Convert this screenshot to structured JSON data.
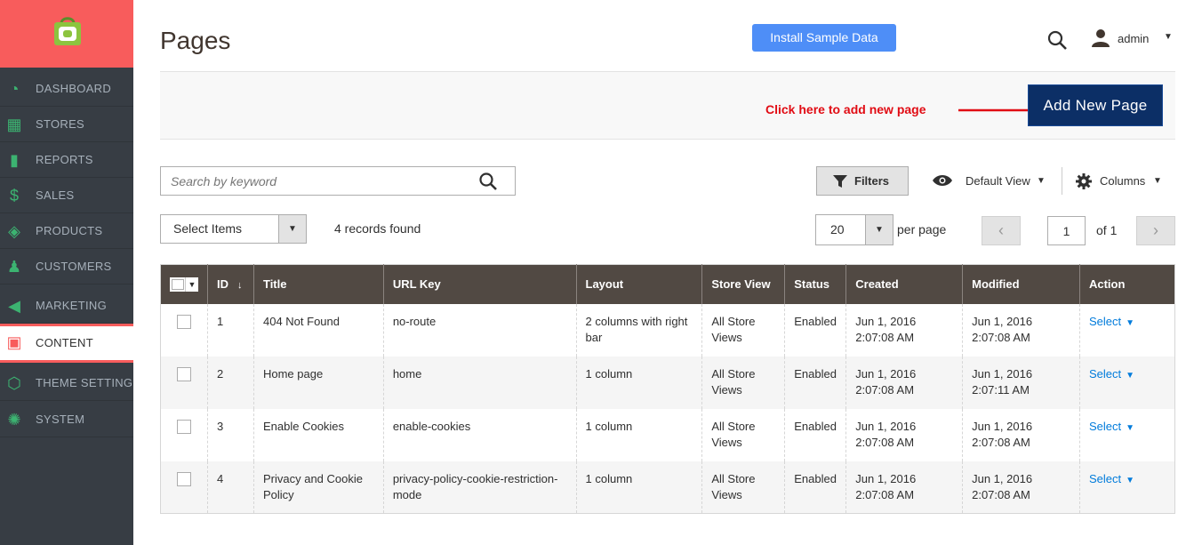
{
  "sidebar": {
    "items": [
      {
        "label": "DASHBOARD",
        "icon": "dashboard-icon"
      },
      {
        "label": "STORES",
        "icon": "stores-icon"
      },
      {
        "label": "REPORTS",
        "icon": "reports-icon"
      },
      {
        "label": "SALES",
        "icon": "dollar-icon"
      },
      {
        "label": "PRODUCTS",
        "icon": "box-icon"
      },
      {
        "label": "CUSTOMERS",
        "icon": "person-icon"
      },
      {
        "label": "MARKETING",
        "icon": "megaphone-icon"
      },
      {
        "label": "CONTENT",
        "icon": "layout-icon"
      },
      {
        "label": "THEME SETTING",
        "icon": "hexagon-icon"
      },
      {
        "label": "SYSTEM",
        "icon": "gear-icon"
      }
    ],
    "active": "CONTENT"
  },
  "header": {
    "title": "Pages",
    "install_label": "Install Sample Data",
    "user": "admin"
  },
  "action_bar": {
    "annotation": "Click here to add new page",
    "add_label": "Add New Page"
  },
  "toolbar": {
    "search_placeholder": "Search by keyword",
    "filters_label": "Filters",
    "view_label": "Default View",
    "columns_label": "Columns",
    "mass_action_label": "Select Items",
    "records_found": "4 records found",
    "per_page_value": "20",
    "per_page_label": "per page",
    "current_page": "1",
    "of_pages": "of 1"
  },
  "grid": {
    "columns": [
      "ID",
      "Title",
      "URL Key",
      "Layout",
      "Store View",
      "Status",
      "Created",
      "Modified",
      "Action"
    ],
    "rows": [
      {
        "id": "1",
        "title": "404 Not Found",
        "url_key": "no-route",
        "layout": "2 columns with right bar",
        "store_view": "All Store Views",
        "status": "Enabled",
        "created": "Jun 1, 2016 2:07:08 AM",
        "modified": "Jun 1, 2016 2:07:08 AM",
        "action": "Select"
      },
      {
        "id": "2",
        "title": "Home page",
        "url_key": "home",
        "layout": "1 column",
        "store_view": "All Store Views",
        "status": "Enabled",
        "created": "Jun 1, 2016 2:07:08 AM",
        "modified": "Jun 1, 2016 2:07:11 AM",
        "action": "Select"
      },
      {
        "id": "3",
        "title": "Enable Cookies",
        "url_key": "enable-cookies",
        "layout": "1 column",
        "store_view": "All Store Views",
        "status": "Enabled",
        "created": "Jun 1, 2016 2:07:08 AM",
        "modified": "Jun 1, 2016 2:07:08 AM",
        "action": "Select"
      },
      {
        "id": "4",
        "title": "Privacy and Cookie Policy",
        "url_key": "privacy-policy-cookie-restriction-mode",
        "layout": "1 column",
        "store_view": "All Store Views",
        "status": "Enabled",
        "created": "Jun 1, 2016 2:07:08 AM",
        "modified": "Jun 1, 2016 2:07:08 AM",
        "action": "Select"
      }
    ]
  },
  "colors": {
    "sidebar_bg": "#373d44",
    "logo_bg": "#f85c5c",
    "nav_icon": "#3cb371",
    "primary_button": "#0c2f66",
    "install_button": "#4e8ef7",
    "annotation": "#e10c14",
    "grid_header": "#514943",
    "link": "#007bdb"
  }
}
